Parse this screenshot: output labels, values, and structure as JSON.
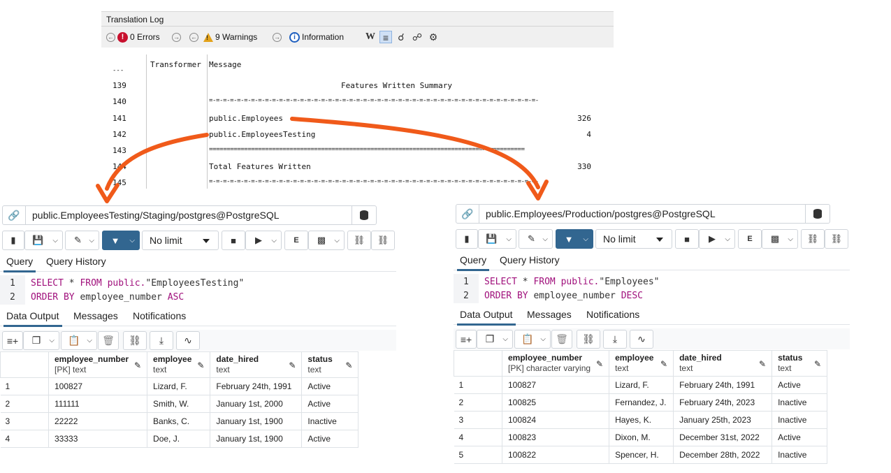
{
  "translation_log": {
    "title": "Translation Log",
    "toolbar": {
      "errors_label": "0 Errors",
      "warnings_label": "9 Warnings",
      "information_label": "Information"
    },
    "columns": {
      "dots": "---",
      "transformer": "Transformer",
      "message": "Message"
    },
    "rows": [
      {
        "num": "139",
        "message": "Features Written Summary",
        "value": ""
      },
      {
        "num": "140",
        "message": "=-=-=-=-=-=-=-=-=-=-=-=-=-=-=-=-=-=-=-=-=-=-=-=-=-=-=-=-=-=-=-=-=-=-=-=-=-=-=-=-=-=-=-=-=-=-=-",
        "value": ""
      },
      {
        "num": "141",
        "message": "public.Employees",
        "value": "326"
      },
      {
        "num": "142",
        "message": "public.EmployeesTesting",
        "value": "4"
      },
      {
        "num": "143",
        "message": "==========================================================================================",
        "value": ""
      },
      {
        "num": "144",
        "message": "Total Features Written",
        "value": "330"
      },
      {
        "num": "145",
        "message": "=-=-=-=-=-=-=-=-=-=-=-=-=-=-=-=-=-=-=-=-=-=-=-=-=-=-=-=-=-=-=-=-=-=-=-=-=-=-=-=-=-=-=-=-=-=-=-",
        "value": ""
      }
    ]
  },
  "left_panel": {
    "connection": "public.EmployeesTesting/Staging/postgres@PostgreSQL",
    "limit": "No limit",
    "tabs": {
      "query": "Query",
      "history": "Query History"
    },
    "sql": {
      "line1_num": "1",
      "line2_num": "2",
      "select": "SELECT",
      "star": " * ",
      "from": "FROM",
      "schema": " public.",
      "table": "\"EmployeesTesting\"",
      "order_by": "ORDER BY",
      "column": " employee_number ",
      "direction": "ASC"
    },
    "output_tabs": {
      "data": "Data Output",
      "messages": "Messages",
      "notifications": "Notifications"
    },
    "columns": [
      {
        "name": "employee_number",
        "type": "[PK] text"
      },
      {
        "name": "employee",
        "type": "text"
      },
      {
        "name": "date_hired",
        "type": "text"
      },
      {
        "name": "status",
        "type": "text"
      }
    ],
    "rows": [
      [
        "1",
        "100827",
        "Lizard, F.",
        "February 24th, 1991",
        "Active"
      ],
      [
        "2",
        "111111",
        "Smith, W.",
        "January 1st, 2000",
        "Active"
      ],
      [
        "3",
        "22222",
        "Banks, C.",
        "January 1st, 1900",
        "Inactive"
      ],
      [
        "4",
        "33333",
        "Doe, J.",
        "January 1st, 1900",
        "Active"
      ]
    ]
  },
  "right_panel": {
    "connection": "public.Employees/Production/postgres@PostgreSQL",
    "limit": "No limit",
    "tabs": {
      "query": "Query",
      "history": "Query History"
    },
    "sql": {
      "line1_num": "1",
      "line2_num": "2",
      "select": "SELECT",
      "star": " * ",
      "from": "FROM",
      "schema": " public.",
      "table": "\"Employees\"",
      "order_by": "ORDER BY",
      "column": " employee_number ",
      "direction": "DESC"
    },
    "output_tabs": {
      "data": "Data Output",
      "messages": "Messages",
      "notifications": "Notifications"
    },
    "columns": [
      {
        "name": "employee_number",
        "type": "[PK] character varying"
      },
      {
        "name": "employee",
        "type": "text"
      },
      {
        "name": "date_hired",
        "type": "text"
      },
      {
        "name": "status",
        "type": "text"
      }
    ],
    "rows": [
      [
        "1",
        "100827",
        "Lizard, F.",
        "February 24th, 1991",
        "Active"
      ],
      [
        "2",
        "100825",
        "Fernandez, J.",
        "February 24th, 2023",
        "Inactive"
      ],
      [
        "3",
        "100824",
        "Hayes, K.",
        "January 25th, 2023",
        "Inactive"
      ],
      [
        "4",
        "100823",
        "Dixon, M.",
        "December 31st, 2022",
        "Active"
      ],
      [
        "5",
        "100822",
        "Spencer, H.",
        "December 28th, 2022",
        "Inactive"
      ]
    ]
  },
  "colors": {
    "accent": "#326690",
    "keyword": "#a0107c",
    "arrow": "#f05a1a",
    "error": "#c8102e",
    "warning": "#e3a21a",
    "info": "#1f5fbf"
  }
}
